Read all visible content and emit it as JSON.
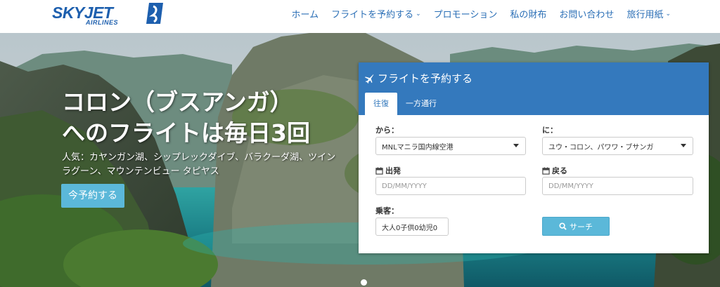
{
  "brand": {
    "name": "SKYJET",
    "sub": "AIRLINES",
    "color": "#1d5fae"
  },
  "nav": [
    {
      "label": "ホーム",
      "dropdown": false
    },
    {
      "label": "フライトを予約する",
      "dropdown": true
    },
    {
      "label": "プロモーション",
      "dropdown": false
    },
    {
      "label": "私の財布",
      "dropdown": false
    },
    {
      "label": "お問い合わせ",
      "dropdown": false
    },
    {
      "label": "旅行用紙",
      "dropdown": true
    }
  ],
  "hero": {
    "title_line1": "コロン（ブスアンガ）",
    "title_line2": "へのフライトは毎日3回",
    "subtitle_line1": "人気：カヤンガン湖、シップレックダイブ、バラクーダ湖、ツイン",
    "subtitle_line2": "ラグーン、マウンテンビュー タピヤス",
    "cta": "今予約する"
  },
  "booking": {
    "title": "フライトを予約する",
    "tabs": [
      {
        "label": "往復",
        "active": true
      },
      {
        "label": "一方通行",
        "active": false
      }
    ],
    "from_label": "から：",
    "from_value": "MNLマニラ国内線空港",
    "to_label": "に：",
    "to_value": "ユウ・コロン、パワワ・ブサンガ",
    "depart_label": "出発",
    "depart_placeholder": "DD/MM/YYYY",
    "return_label": "戻る",
    "return_placeholder": "DD/MM/YYYY",
    "passengers_label": "乗客：",
    "passengers_value": "大人0子供0幼児0",
    "search_label": "サーチ"
  },
  "colors": {
    "panel_header": "#3479bd",
    "button": "#5bb8d9",
    "nav_text": "#2b6fb6"
  }
}
